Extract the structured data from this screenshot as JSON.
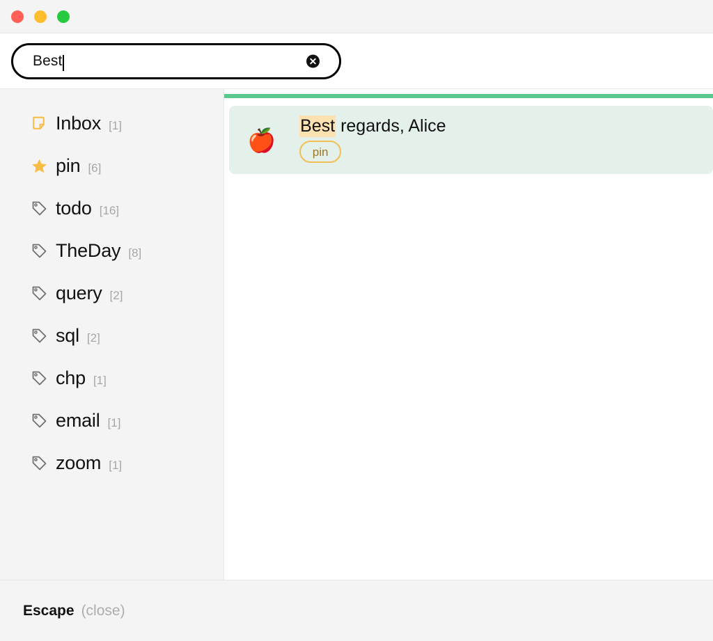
{
  "window": {
    "traffic_lights": [
      {
        "name": "close",
        "color": "#ff5f56"
      },
      {
        "name": "minimize",
        "color": "#ffbd2e"
      },
      {
        "name": "maximize",
        "color": "#27c93f"
      }
    ]
  },
  "search": {
    "value": "Best",
    "placeholder": "Search",
    "clear_icon": "close-circle-icon"
  },
  "sidebar": {
    "items": [
      {
        "label": "Inbox",
        "count": "[1]",
        "icon": "note-icon"
      },
      {
        "label": "pin",
        "count": "[6]",
        "icon": "star-icon"
      },
      {
        "label": "todo",
        "count": "[16]",
        "icon": "tag-icon"
      },
      {
        "label": "TheDay",
        "count": "[8]",
        "icon": "tag-icon"
      },
      {
        "label": "query",
        "count": "[2]",
        "icon": "tag-icon"
      },
      {
        "label": "sql",
        "count": "[2]",
        "icon": "tag-icon"
      },
      {
        "label": "chp",
        "count": "[1]",
        "icon": "tag-icon"
      },
      {
        "label": "email",
        "count": "[1]",
        "icon": "tag-icon"
      },
      {
        "label": "zoom",
        "count": "[1]",
        "icon": "tag-icon"
      }
    ]
  },
  "results": {
    "accent_color": "#5ac88d",
    "items": [
      {
        "emoji": "🍎",
        "title_highlight": "Best",
        "title_rest": " regards, Alice",
        "tags": [
          "pin"
        ]
      }
    ]
  },
  "footer": {
    "key": "Escape",
    "action": "(close)"
  },
  "colors": {
    "accent_green": "#5ac88d",
    "card_bg": "#e4f0ea",
    "highlight": "#fce2b0",
    "tag_border": "#f2bf54",
    "tag_text": "#a07622",
    "sidebar_bg": "#f4f4f5",
    "icon_amber": "#f8bd45",
    "icon_gray": "#6f6f72"
  }
}
